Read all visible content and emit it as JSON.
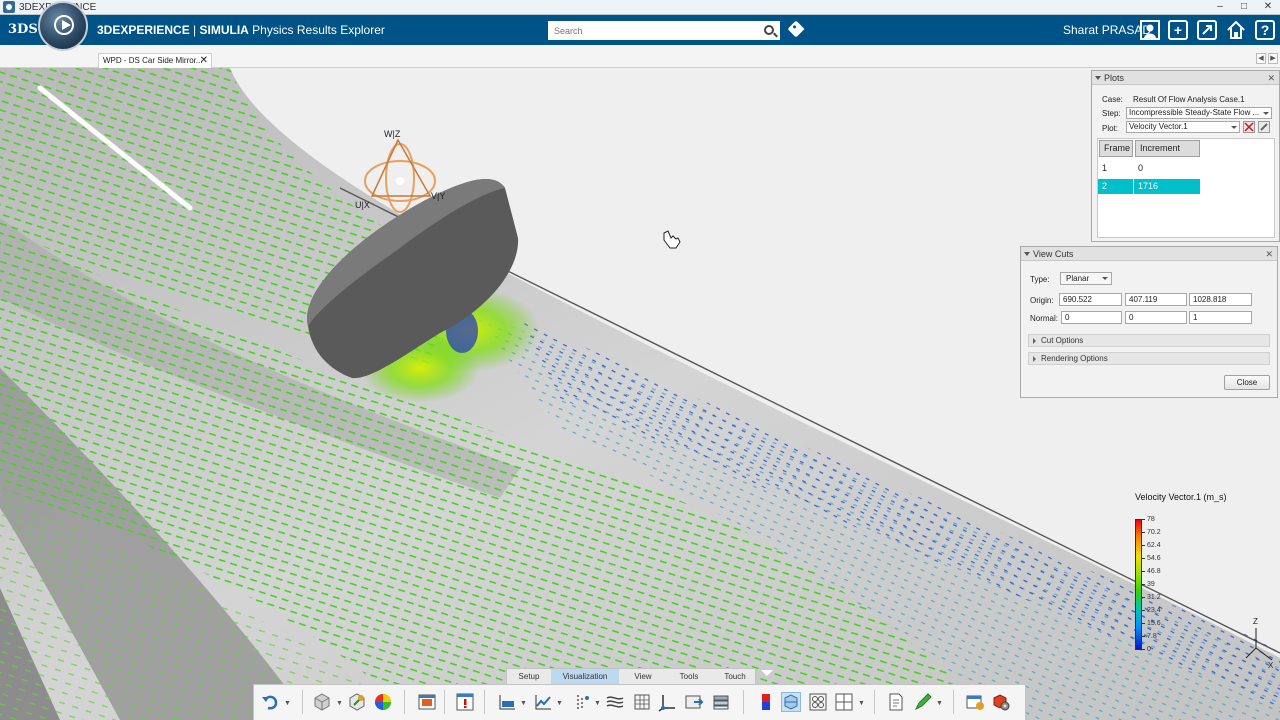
{
  "os_bar": {
    "title": "3DEXPERIENCE",
    "minimize": "–",
    "maximize": "□",
    "close": "✕"
  },
  "header": {
    "brand_logo": "3DS",
    "app_brand": "3DEXPERIENCE",
    "app_sep": " | ",
    "app_product": "SIMULIA",
    "app_name": " Physics Results Explorer",
    "search_placeholder": "Search",
    "user_name": "Sharat PRASAD",
    "btn_add": "+",
    "btn_help": "?"
  },
  "tabs": {
    "doc_tab": "WPD - DS Car Side Mirror...",
    "doc_close": "✕",
    "nav_prev": "◀",
    "nav_next": "▶"
  },
  "viewport": {
    "axis_labels": {
      "wz": "W|Z",
      "ux": "U|X",
      "vy": "V|Y"
    },
    "triad_labels": {
      "z": "Z",
      "x": "X"
    }
  },
  "plots": {
    "title": "Plots",
    "close": "✕",
    "case_label": "Case:",
    "case_value": "Result Of Flow Analysis Case.1",
    "step_label": "Step:",
    "step_value": "Incompressible Steady-State Flow ...",
    "plot_label": "Plot:",
    "plot_value": "Velocity Vector.1",
    "table_headers": [
      "Frame",
      "Increment"
    ],
    "rows": [
      {
        "frame": "1",
        "increment": "0"
      },
      {
        "frame": "2",
        "increment": "1716"
      }
    ]
  },
  "view_cuts": {
    "title": "View Cuts",
    "close": "✕",
    "type_label": "Type:",
    "type_value": "Planar",
    "origin_label": "Origin:",
    "origin": [
      "690.522",
      "407.119",
      "1028.818"
    ],
    "normal_label": "Normal:",
    "normal": [
      "0",
      "0",
      "1"
    ],
    "cut_options": "Cut Options",
    "rendering_options": "Rendering Options",
    "close_button": "Close"
  },
  "legend": {
    "title": "Velocity Vector.1 (m_s)",
    "ticks": [
      "78",
      "70.2",
      "62.4",
      "54.6",
      "46.8",
      "39",
      "31.2",
      "23.4",
      "15.6",
      "7.8",
      "0"
    ],
    "colors": {
      "max": "#e8001a",
      "mid": "#36d400",
      "min": "#0a16c8"
    }
  },
  "action_bar": {
    "tabs": [
      "Setup",
      "Visualization",
      "View",
      "Tools",
      "Touch"
    ],
    "active_tab": "Visualization",
    "tools": [
      "undo-icon",
      "part-icon",
      "mesh-icon",
      "results-icon",
      "image-icon",
      "warning-icon",
      "bar-chart-icon",
      "xy-plot-icon",
      "probe-icon",
      "streamline-icon",
      "section-icon",
      "axis-icon",
      "export-icon",
      "stack-icon",
      "color-icon",
      "cut-plane-icon",
      "grid-view-icon",
      "layout-icon",
      "report-icon",
      "pen-icon",
      "snapshot-icon",
      "settings-icon"
    ]
  },
  "accent": {
    "header_blue": "#005386",
    "selection_cyan": "#00c0cc",
    "active_tab": "#bcd9ef"
  }
}
